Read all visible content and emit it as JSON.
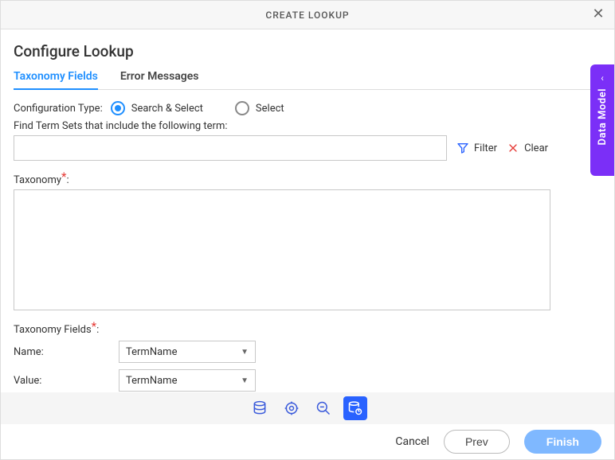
{
  "header": {
    "title": "CREATE LOOKUP"
  },
  "heading": "Configure Lookup",
  "tabs": [
    {
      "label": "Taxonomy Fields",
      "active": true
    },
    {
      "label": "Error Messages",
      "active": false
    }
  ],
  "config": {
    "label": "Configuration Type:",
    "options": [
      {
        "label": "Search & Select",
        "selected": true
      },
      {
        "label": "Select",
        "selected": false
      }
    ]
  },
  "search": {
    "hint": "Find Term Sets that include the following term:",
    "value": "",
    "filter_label": "Filter",
    "clear_label": "Clear"
  },
  "taxonomy": {
    "label": "Taxonomy",
    "colon": ":"
  },
  "taxonomy_fields": {
    "label": "Taxonomy Fields",
    "colon": ":",
    "name_label": "Name:",
    "name_value": "TermName",
    "value_label": "Value:",
    "value_value": "TermName"
  },
  "icon_strip": [
    {
      "name": "database-icon",
      "active": false
    },
    {
      "name": "gear-target-icon",
      "active": false
    },
    {
      "name": "zoom-out-icon",
      "active": false
    },
    {
      "name": "database-config-icon",
      "active": true
    }
  ],
  "footer": {
    "cancel": "Cancel",
    "prev": "Prev",
    "finish": "Finish"
  },
  "side_panel": {
    "label": "Data Model"
  },
  "colors": {
    "accent_blue": "#1f8fff",
    "primary_button": "#7fb8ff",
    "side_purple": "#7b2ff7",
    "required_red": "#e53935"
  }
}
